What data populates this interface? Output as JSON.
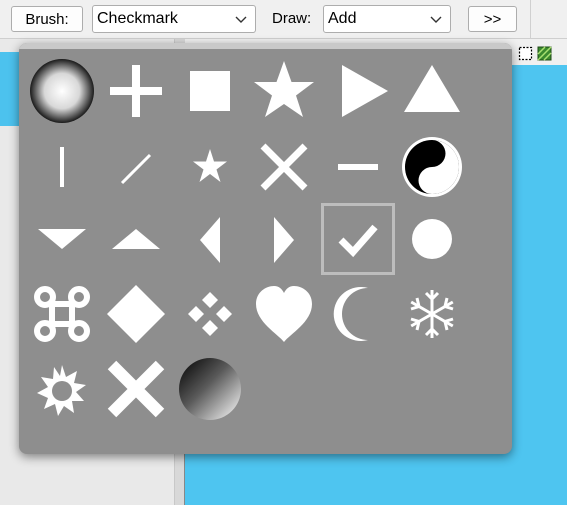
{
  "toolbar": {
    "brush_button": "Brush:",
    "brush_value": "Checkmark",
    "draw_label": "Draw:",
    "draw_value": "Add",
    "more_button": ">>"
  },
  "brushes": {
    "selected": "Checkmark",
    "items": [
      {
        "icon": "sphere-soft-icon"
      },
      {
        "icon": "plus-icon"
      },
      {
        "icon": "square-icon"
      },
      {
        "icon": "star-icon"
      },
      {
        "icon": "triangle-right-icon"
      },
      {
        "icon": "triangle-up-icon"
      },
      {
        "icon": "vertical-line-icon"
      },
      {
        "icon": "diagonal-line-icon"
      },
      {
        "icon": "small-star-icon"
      },
      {
        "icon": "x-icon"
      },
      {
        "icon": "horizontal-line-icon"
      },
      {
        "icon": "yin-yang-icon"
      },
      {
        "icon": "triangle-down-small-icon"
      },
      {
        "icon": "triangle-up-small-icon"
      },
      {
        "icon": "triangle-left-small-icon"
      },
      {
        "icon": "triangle-right-small-icon"
      },
      {
        "icon": "checkmark-icon"
      },
      {
        "icon": "circle-icon"
      },
      {
        "icon": "command-key-icon"
      },
      {
        "icon": "diamond-icon"
      },
      {
        "icon": "four-diamonds-icon"
      },
      {
        "icon": "heart-icon"
      },
      {
        "icon": "crescent-moon-icon"
      },
      {
        "icon": "snowflake-icon"
      },
      {
        "icon": "sun-icon"
      },
      {
        "icon": "bold-x-icon"
      },
      {
        "icon": "gradient-sphere-icon"
      }
    ]
  }
}
